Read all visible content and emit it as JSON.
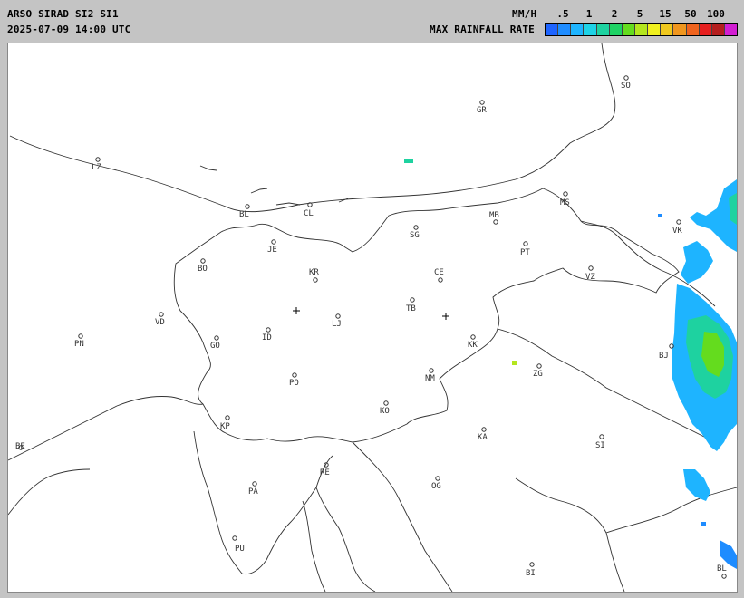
{
  "header": {
    "title": "ARSO SIRAD SI2 SI1",
    "timestamp": "2025-07-09 14:00 UTC",
    "unit": "MM/H",
    "legend_title": "MAX RAINFALL RATE",
    "ticks": [
      ".5",
      "1",
      "2",
      "5",
      "15",
      "50",
      "100"
    ],
    "scale_colors": [
      "#1e64ff",
      "#1e8cff",
      "#1eb4ff",
      "#1ed2e6",
      "#1ed2a0",
      "#1ed264",
      "#64dc1e",
      "#b4e61e",
      "#f0f01e",
      "#f0c81e",
      "#f0961e",
      "#f0641e",
      "#e61e1e",
      "#b41e1e",
      "#d21ed2"
    ]
  },
  "cities": [
    {
      "name": "GR"
    },
    {
      "name": "SO"
    },
    {
      "name": "LZ"
    },
    {
      "name": "BL"
    },
    {
      "name": "CL"
    },
    {
      "name": "MS"
    },
    {
      "name": "MB"
    },
    {
      "name": "VK"
    },
    {
      "name": "SG"
    },
    {
      "name": "PT"
    },
    {
      "name": "JE"
    },
    {
      "name": "BO"
    },
    {
      "name": "KR"
    },
    {
      "name": "CE"
    },
    {
      "name": "VZ"
    },
    {
      "name": "TB"
    },
    {
      "name": "VD"
    },
    {
      "name": "LJ"
    },
    {
      "name": "PN"
    },
    {
      "name": "ID"
    },
    {
      "name": "GO"
    },
    {
      "name": "KK"
    },
    {
      "name": "BJ"
    },
    {
      "name": "ZG"
    },
    {
      "name": "PO"
    },
    {
      "name": "NM"
    },
    {
      "name": "KO"
    },
    {
      "name": "KP"
    },
    {
      "name": "KA"
    },
    {
      "name": "SI"
    },
    {
      "name": "BE"
    },
    {
      "name": "RE"
    },
    {
      "name": "PA"
    },
    {
      "name": "OG"
    },
    {
      "name": "PU"
    },
    {
      "name": "BI"
    },
    {
      "name": "BL"
    }
  ],
  "colors": {
    "background": "#c4c4c4",
    "map_background": "#ffffff",
    "outline": "#333333",
    "rain_light": "#1eb4ff",
    "rain_mid": "#1ed2a0",
    "rain_heavy": "#64dc1e"
  }
}
